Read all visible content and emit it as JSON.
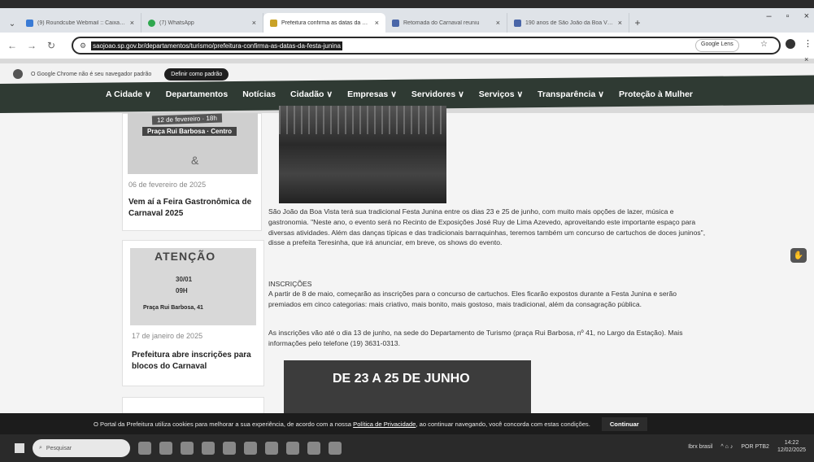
{
  "browser": {
    "tabs": [
      {
        "title": "(9) Roundcube Webmail :: Caixa de entrada",
        "active": false
      },
      {
        "title": "(7) WhatsApp",
        "active": false
      },
      {
        "title": "Prefeitura confirma as datas da Festa Junina",
        "active": true
      },
      {
        "title": "Retomada do Carnaval reuniu",
        "active": false
      },
      {
        "title": "190 anos de São João da Boa Vista",
        "active": false
      }
    ],
    "url": "saojoao.sp.gov.br/departamentos/turismo/prefeitura-confirma-as-datas-da-festa-junina",
    "lens_label": "Google Lens",
    "infobar_text": "O Google Chrome não é seu navegador padrão",
    "infobar_button": "Definir como padrão"
  },
  "site_nav": {
    "items": [
      "A Cidade ∨",
      "Departamentos",
      "Notícias",
      "Cidadão ∨",
      "Empresas ∨",
      "Servidores ∨",
      "Serviços ∨",
      "Transparência ∨",
      "Proteção à Mulher"
    ]
  },
  "sidebar": {
    "cards": [
      {
        "thumb_line1": "12 de fevereiro · 18h",
        "thumb_line2": "Praça Rui Barbosa · Centro",
        "thumb_symbol": "&",
        "date": "06 de fevereiro de 2025",
        "title": "Vem aí a Feira Gastronômica de Carnaval 2025"
      },
      {
        "thumb_title": "ATENÇÃO",
        "thumb_date": "30/01",
        "thumb_time": "09H",
        "thumb_place": "Praça Rui Barbosa, 41",
        "date": "17 de janeiro de 2025",
        "title": "Prefeitura abre inscrições para blocos do Carnaval"
      }
    ]
  },
  "article": {
    "p1": "São João da Boa Vista terá sua tradicional Festa Junina entre os dias 23 e 25 de junho, com muito mais opções de lazer, música e gastronomia. \"Neste ano, o evento será no Recinto de Exposições José Ruy de Lima Azevedo, aproveitando este importante espaço para diversas atividades. Além das danças típicas e das tradicionais barraquinhas, teremos também um concurso de cartuchos de doces juninos\", disse a prefeita Teresinha, que irá anunciar, em breve, os shows do evento.",
    "p2_heading": "INSCRIÇÕES",
    "p2": "A partir de 8 de maio, começarão as inscrições para o concurso de cartuchos. Eles ficarão expostos durante a Festa Junina e serão premiados em cinco categorias: mais criativo, mais bonito, mais gostoso, mais tradicional, além da consagração pública.",
    "p3": "As inscrições vão até o dia 13 de junho, na sede do Departamento de Turismo (praça Rui Barbosa, nº 41, no Largo da Estação). Mais informações pelo telefone (19) 3631-0313.",
    "banner_text": "DE 23 A 25 DE JUNHO"
  },
  "cookie": {
    "text_before": "O Portal da Prefeitura utiliza cookies para melhorar a sua experiência, de acordo com a nossa",
    "link": "Política de Privacidade",
    "text_after": ", ao continuar navegando, você concorda com estas condições.",
    "button": "Continuar"
  },
  "taskbar": {
    "search_placeholder": "Pesquisar",
    "news": "Ibrx brasil",
    "lang": "POR PTB2",
    "time": "14:22",
    "date": "12/02/2025"
  }
}
